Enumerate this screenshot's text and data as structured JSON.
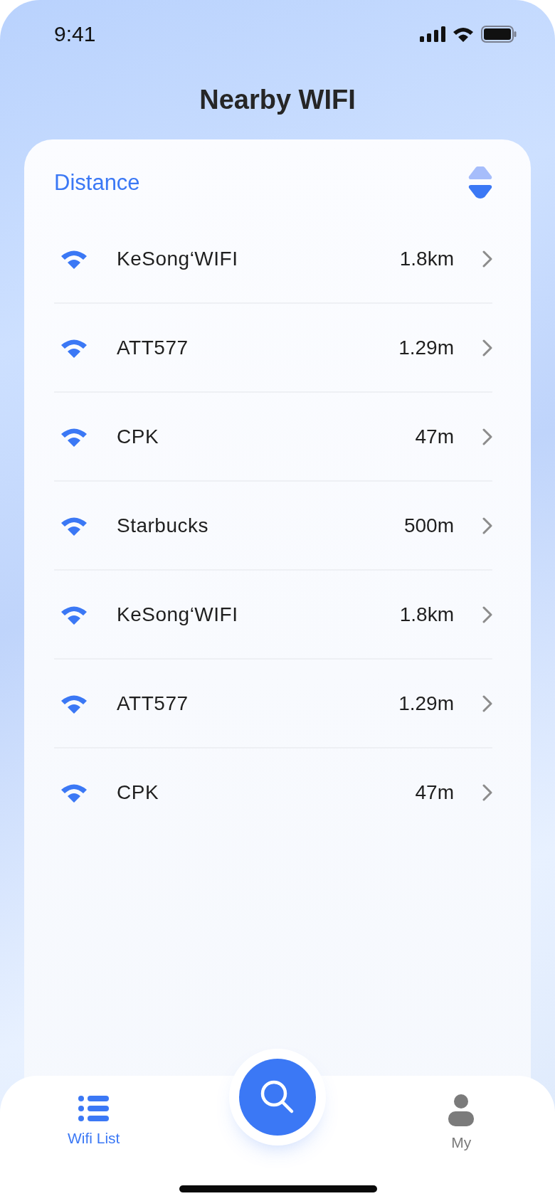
{
  "status_bar": {
    "time": "9:41"
  },
  "title": "Nearby WIFI",
  "list": {
    "sort_label": "Distance",
    "networks": [
      {
        "name": "KeSong‘WIFI",
        "distance": "1.8km"
      },
      {
        "name": "ATT577",
        "distance": "1.29m"
      },
      {
        "name": "CPK",
        "distance": "47m"
      },
      {
        "name": "Starbucks",
        "distance": "500m"
      },
      {
        "name": "KeSong‘WIFI",
        "distance": "1.8km"
      },
      {
        "name": "ATT577",
        "distance": "1.29m"
      },
      {
        "name": "CPK",
        "distance": "47m"
      }
    ]
  },
  "tab_bar": {
    "tabs": [
      {
        "label": "Wifi List",
        "kind": "list",
        "selected": true
      },
      {
        "kind": "search"
      },
      {
        "label": "My",
        "kind": "profile",
        "selected": false
      }
    ]
  }
}
